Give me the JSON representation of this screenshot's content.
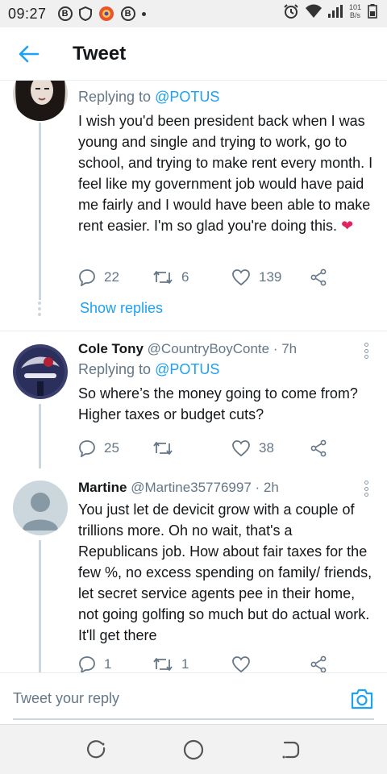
{
  "status_bar": {
    "time": "09:27",
    "left_icons": [
      "b-circle-icon",
      "shield-icon",
      "notification-app-icon",
      "b-circle-icon",
      "dot-icon"
    ],
    "b_letter": "B",
    "right_icons": [
      "alarm-icon",
      "wifi-icon",
      "signal-icon",
      "battery-icon"
    ],
    "net_speed_value": "101",
    "net_speed_unit": "B/s"
  },
  "header": {
    "title": "Tweet",
    "back_icon": "arrow-left-icon",
    "accent_color": "#1da1f2"
  },
  "tweets": [
    {
      "reply_prefix": "Replying to ",
      "reply_to": "@POTUS",
      "text": "I wish you'd been president back when I was young and single and trying to work, go to school, and trying to make rent every month. I feel like my government job would have paid me fairly and I would have been able to make rent easier. I'm so glad you're doing this.",
      "emoji": "❤",
      "counts": {
        "replies": "22",
        "retweets": "6",
        "likes": "139"
      },
      "show_replies": "Show replies"
    },
    {
      "name": "Cole Tony",
      "handle": "@CountryBoyConte",
      "time": " · 7h",
      "reply_prefix": "Replying to ",
      "reply_to": "@POTUS",
      "text": "So where’s the money going to come from? Higher taxes or budget cuts?",
      "counts": {
        "replies": "25",
        "retweets": "",
        "likes": "38"
      }
    },
    {
      "name": "Martine",
      "handle": "@Martine35776997",
      "time": " · 2h",
      "text": "You just let de devicit grow with a couple of trillions more. Oh no wait, that's a Republicans job. How about fair taxes for the few %, no excess spending on family/ friends, let secret service agents pee in their home, not going golfing so much but do actual work. It'll get there",
      "counts": {
        "replies": "1",
        "retweets": "1",
        "likes": ""
      }
    }
  ],
  "reply_bar": {
    "placeholder": "Tweet your reply",
    "camera_icon": "camera-icon"
  },
  "nav_bar": {
    "icons": [
      "recent-apps-icon",
      "home-circle-icon",
      "back-nav-icon"
    ]
  }
}
